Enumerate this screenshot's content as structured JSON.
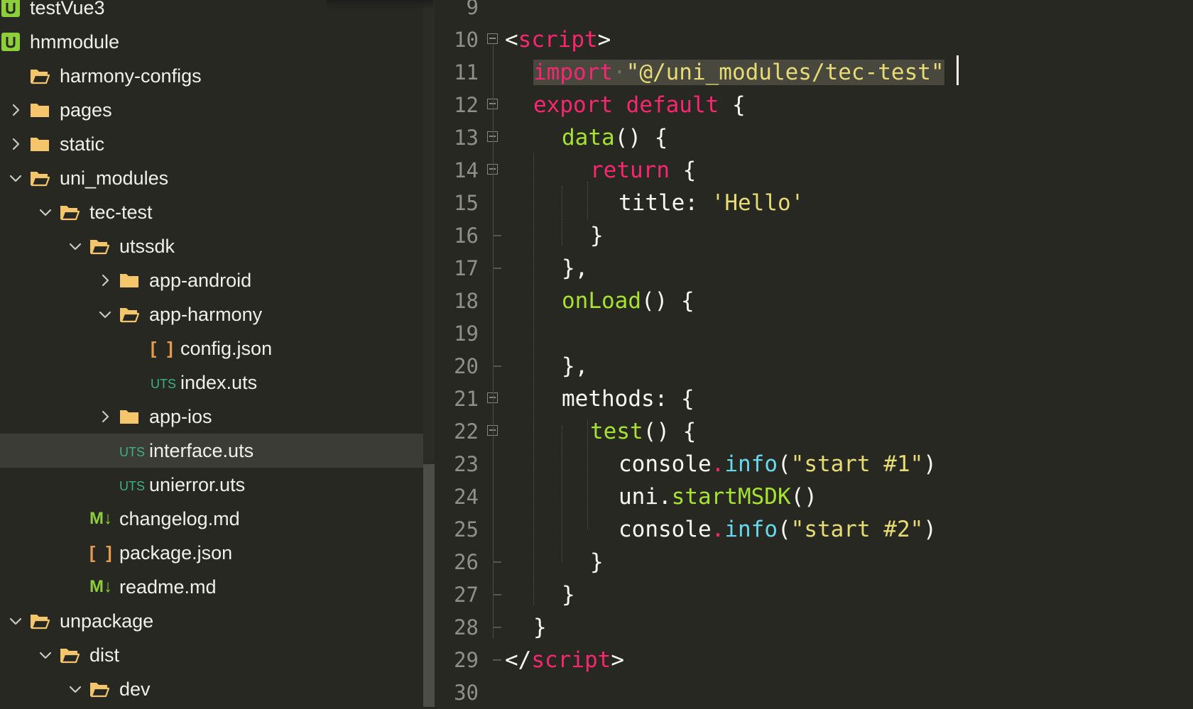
{
  "sidebar": {
    "rows": [
      {
        "label": "testVue3",
        "icon": "project-icon",
        "chevron": "none"
      },
      {
        "label": "hmmodule",
        "icon": "project-icon",
        "chevron": "none"
      },
      {
        "label": "harmony-configs",
        "icon": "folder-open-icon",
        "chevron": "none"
      },
      {
        "label": "pages",
        "icon": "folder-icon",
        "chevron": "right"
      },
      {
        "label": "static",
        "icon": "folder-icon",
        "chevron": "right"
      },
      {
        "label": "uni_modules",
        "icon": "folder-open-icon",
        "chevron": "down"
      },
      {
        "label": "tec-test",
        "icon": "folder-open-icon",
        "chevron": "down"
      },
      {
        "label": "utssdk",
        "icon": "folder-open-icon",
        "chevron": "down"
      },
      {
        "label": "app-android",
        "icon": "folder-icon",
        "chevron": "right"
      },
      {
        "label": "app-harmony",
        "icon": "folder-open-icon",
        "chevron": "down"
      },
      {
        "label": "config.json",
        "icon": "json-file-icon",
        "chevron": "none",
        "icon_text": "[ ]"
      },
      {
        "label": "index.uts",
        "icon": "uts-file-icon",
        "chevron": "none",
        "icon_text": "UTS"
      },
      {
        "label": "app-ios",
        "icon": "folder-icon",
        "chevron": "right"
      },
      {
        "label": "interface.uts",
        "icon": "uts-file-icon",
        "chevron": "none",
        "icon_text": "UTS",
        "selected": true
      },
      {
        "label": "unierror.uts",
        "icon": "uts-file-icon",
        "chevron": "none",
        "icon_text": "UTS"
      },
      {
        "label": "changelog.md",
        "icon": "markdown-file-icon",
        "chevron": "none",
        "icon_text": "M↓"
      },
      {
        "label": "package.json",
        "icon": "json-file-icon",
        "chevron": "none",
        "icon_text": "[ ]"
      },
      {
        "label": "readme.md",
        "icon": "markdown-file-icon",
        "chevron": "none",
        "icon_text": "M↓"
      },
      {
        "label": "unpackage",
        "icon": "folder-open-icon",
        "chevron": "down"
      },
      {
        "label": "dist",
        "icon": "folder-open-icon",
        "chevron": "down"
      },
      {
        "label": "dev",
        "icon": "folder-open-icon",
        "chevron": "down"
      }
    ],
    "colors": {
      "folder": "#f5c56b",
      "project": "#8ccf3a",
      "json": "#e69a4a",
      "uts": "#3fae8c",
      "markdown": "#8ccf3a"
    }
  },
  "editor": {
    "lines": [
      {
        "num": "9",
        "tokens": [],
        "fold": "none"
      },
      {
        "num": "10",
        "fold": "open",
        "tokens": [
          [
            "t-plain",
            "<"
          ],
          [
            "t-kw",
            "script"
          ],
          [
            "t-plain",
            ">"
          ]
        ]
      },
      {
        "num": "11",
        "fold": "none",
        "tokens": [
          [
            "t-kw sel",
            "import"
          ],
          [
            "dot sel",
            "·"
          ],
          [
            "t-str sel",
            "\"@/uni_modules/tec-test\""
          ]
        ]
      },
      {
        "num": "12",
        "fold": "open",
        "tokens": [
          [
            "t-kw",
            "export"
          ],
          [
            "t-plain",
            " "
          ],
          [
            "t-kw",
            "default"
          ],
          [
            "t-plain",
            " {"
          ]
        ]
      },
      {
        "num": "13",
        "fold": "open",
        "tokens": [
          [
            "t-fn",
            "data"
          ],
          [
            "t-plain",
            "() {"
          ]
        ]
      },
      {
        "num": "14",
        "fold": "open",
        "tokens": [
          [
            "t-kw",
            "return"
          ],
          [
            "t-plain",
            " {"
          ]
        ]
      },
      {
        "num": "15",
        "fold": "none",
        "tokens": [
          [
            "t-plain",
            "title: "
          ],
          [
            "t-str",
            "'Hello'"
          ]
        ]
      },
      {
        "num": "16",
        "fold": "end",
        "tokens": [
          [
            "t-plain",
            "}"
          ]
        ]
      },
      {
        "num": "17",
        "fold": "end",
        "tokens": [
          [
            "t-plain",
            "},"
          ]
        ]
      },
      {
        "num": "18",
        "fold": "none",
        "tokens": [
          [
            "t-fn",
            "onLoad"
          ],
          [
            "t-plain",
            "() {"
          ]
        ]
      },
      {
        "num": "19",
        "fold": "none",
        "tokens": []
      },
      {
        "num": "20",
        "fold": "end",
        "tokens": [
          [
            "t-plain",
            "},"
          ]
        ]
      },
      {
        "num": "21",
        "fold": "open",
        "tokens": [
          [
            "t-plain",
            "methods: {"
          ]
        ]
      },
      {
        "num": "22",
        "fold": "open",
        "tokens": [
          [
            "t-fn",
            "test"
          ],
          [
            "t-plain",
            "() {"
          ]
        ]
      },
      {
        "num": "23",
        "fold": "none",
        "tokens": [
          [
            "t-plain",
            "console"
          ],
          [
            "t-kw",
            "."
          ],
          [
            "t-ident",
            "info"
          ],
          [
            "t-plain",
            "("
          ],
          [
            "t-str",
            "\"start #1\""
          ],
          [
            "t-plain",
            ")"
          ]
        ]
      },
      {
        "num": "24",
        "fold": "none",
        "tokens": [
          [
            "t-plain",
            "uni."
          ],
          [
            "t-fn",
            "startMSDK"
          ],
          [
            "t-plain",
            "()"
          ]
        ]
      },
      {
        "num": "25",
        "fold": "none",
        "tokens": [
          [
            "t-plain",
            "console"
          ],
          [
            "t-kw",
            "."
          ],
          [
            "t-ident",
            "info"
          ],
          [
            "t-plain",
            "("
          ],
          [
            "t-str",
            "\"start #2\""
          ],
          [
            "t-plain",
            ")"
          ]
        ]
      },
      {
        "num": "26",
        "fold": "end",
        "tokens": [
          [
            "t-plain",
            "}"
          ]
        ]
      },
      {
        "num": "27",
        "fold": "end",
        "tokens": [
          [
            "t-plain",
            "}"
          ]
        ]
      },
      {
        "num": "28",
        "fold": "end",
        "tokens": [
          [
            "t-plain",
            "}"
          ]
        ]
      },
      {
        "num": "29",
        "fold": "end",
        "tokens": [
          [
            "t-plain",
            "</"
          ],
          [
            "t-kw",
            "script"
          ],
          [
            "t-plain",
            ">"
          ]
        ]
      },
      {
        "num": "30",
        "fold": "none",
        "tokens": []
      }
    ],
    "colors": {
      "background": "#272822",
      "keyword": "#f92672",
      "function": "#a6e22e",
      "string": "#e6db74",
      "identifier": "#66d9ef",
      "selection": "#49483e"
    }
  }
}
